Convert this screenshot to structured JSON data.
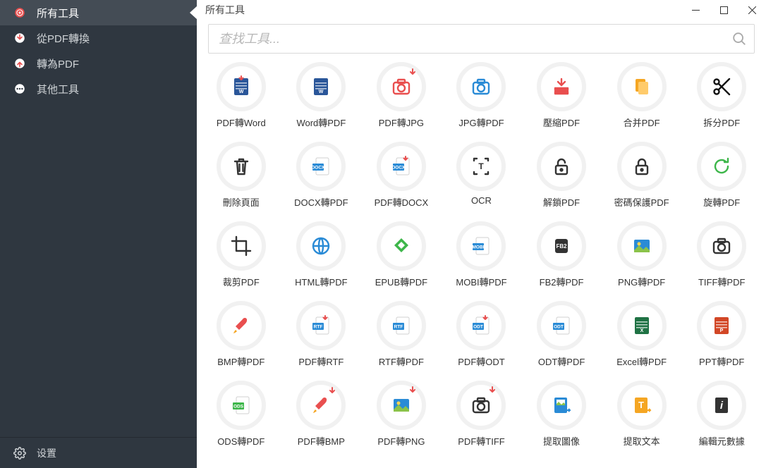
{
  "sidebar": {
    "items": [
      {
        "label": "所有工具",
        "name": "all-tools"
      },
      {
        "label": "從PDF轉換",
        "name": "from-pdf"
      },
      {
        "label": "轉為PDF",
        "name": "to-pdf"
      },
      {
        "label": "其他工具",
        "name": "other-tools"
      }
    ],
    "settings": "设置"
  },
  "main": {
    "title": "所有工具",
    "searchPlaceholder": "查找工具..."
  },
  "tools": [
    {
      "label": "PDF轉Word",
      "icon": "word-down",
      "name": "pdf-to-word",
      "c": "#2a5699"
    },
    {
      "label": "Word轉PDF",
      "icon": "word",
      "name": "word-to-pdf",
      "c": "#2a5699"
    },
    {
      "label": "PDF轉JPG",
      "icon": "camera-down",
      "name": "pdf-to-jpg",
      "c": "#e94f4f"
    },
    {
      "label": "JPG轉PDF",
      "icon": "camera-blue",
      "name": "jpg-to-pdf",
      "c": "#2a8bd6"
    },
    {
      "label": "壓縮PDF",
      "icon": "compress",
      "name": "compress-pdf",
      "c": "#e94f4f"
    },
    {
      "label": "合并PDF",
      "icon": "merge",
      "name": "merge-pdf",
      "c": "#f5a623"
    },
    {
      "label": "拆分PDF",
      "icon": "scissors",
      "name": "split-pdf",
      "c": "#111"
    },
    {
      "label": "刪除頁面",
      "icon": "trash",
      "name": "delete-pages",
      "c": "#333"
    },
    {
      "label": "DOCX轉PDF",
      "icon": "docx",
      "name": "docx-to-pdf",
      "c": "#2a8bd6"
    },
    {
      "label": "PDF轉DOCX",
      "icon": "docx-down",
      "name": "pdf-to-docx",
      "c": "#2a8bd6"
    },
    {
      "label": "OCR",
      "icon": "ocr",
      "name": "ocr",
      "c": "#333"
    },
    {
      "label": "解鎖PDF",
      "icon": "unlock",
      "name": "unlock-pdf",
      "c": "#333"
    },
    {
      "label": "密碼保護PDF",
      "icon": "lock",
      "name": "lock-pdf",
      "c": "#333"
    },
    {
      "label": "旋轉PDF",
      "icon": "rotate",
      "name": "rotate-pdf",
      "c": "#3db64a"
    },
    {
      "label": "裁剪PDF",
      "icon": "crop",
      "name": "crop-pdf",
      "c": "#333"
    },
    {
      "label": "HTML轉PDF",
      "icon": "globe",
      "name": "html-to-pdf",
      "c": "#2a8bd6"
    },
    {
      "label": "EPUB轉PDF",
      "icon": "epub",
      "name": "epub-to-pdf",
      "c": "#3db64a"
    },
    {
      "label": "MOBI轉PDF",
      "icon": "mobi",
      "name": "mobi-to-pdf",
      "c": "#2a8bd6"
    },
    {
      "label": "FB2轉PDF",
      "icon": "fb2",
      "name": "fb2-to-pdf",
      "c": "#333"
    },
    {
      "label": "PNG轉PDF",
      "icon": "image",
      "name": "png-to-pdf",
      "c": "#2a8bd6"
    },
    {
      "label": "TIFF轉PDF",
      "icon": "camera",
      "name": "tiff-to-pdf",
      "c": "#333"
    },
    {
      "label": "BMP轉PDF",
      "icon": "brush",
      "name": "bmp-to-pdf",
      "c": "#e94f4f"
    },
    {
      "label": "PDF轉RTF",
      "icon": "rtf-down",
      "name": "pdf-to-rtf",
      "c": "#2a8bd6"
    },
    {
      "label": "RTF轉PDF",
      "icon": "rtf",
      "name": "rtf-to-pdf",
      "c": "#2a8bd6"
    },
    {
      "label": "PDF轉ODT",
      "icon": "odt-down",
      "name": "pdf-to-odt",
      "c": "#2a8bd6"
    },
    {
      "label": "ODT轉PDF",
      "icon": "odt",
      "name": "odt-to-pdf",
      "c": "#2a8bd6"
    },
    {
      "label": "Excel轉PDF",
      "icon": "excel",
      "name": "excel-to-pdf",
      "c": "#1f7244"
    },
    {
      "label": "PPT轉PDF",
      "icon": "ppt",
      "name": "ppt-to-pdf",
      "c": "#d24726"
    },
    {
      "label": "ODS轉PDF",
      "icon": "ods",
      "name": "ods-to-pdf",
      "c": "#3db64a"
    },
    {
      "label": "PDF轉BMP",
      "icon": "brush-down",
      "name": "pdf-to-bmp",
      "c": "#e94f4f"
    },
    {
      "label": "PDF轉PNG",
      "icon": "image-down",
      "name": "pdf-to-png",
      "c": "#2a8bd6"
    },
    {
      "label": "PDF轉TIFF",
      "icon": "camera-down2",
      "name": "pdf-to-tiff",
      "c": "#333"
    },
    {
      "label": "提取圖像",
      "icon": "extract-image",
      "name": "extract-images",
      "c": "#2a8bd6"
    },
    {
      "label": "提取文本",
      "icon": "extract-text",
      "name": "extract-text",
      "c": "#f5a623"
    },
    {
      "label": "編輯元數據",
      "icon": "meta",
      "name": "edit-metadata",
      "c": "#333"
    }
  ]
}
